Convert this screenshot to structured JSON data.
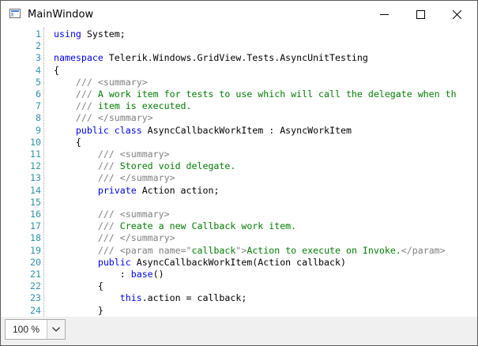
{
  "window": {
    "title": "MainWindow",
    "app_icon": "window-app-icon",
    "controls": {
      "minimize_icon": "minimize-icon",
      "maximize_icon": "maximize-icon",
      "close_icon": "close-icon"
    }
  },
  "editor": {
    "colors": {
      "keyword": "#0000ff",
      "comment": "#008000",
      "xml_doc_tag": "#808080",
      "string": "#a31515",
      "line_number": "#2b91af",
      "text": "#000000"
    },
    "lines": [
      {
        "number": "1",
        "tokens": [
          {
            "t": "kw",
            "v": "using"
          },
          {
            "t": "tx",
            "v": " System;"
          }
        ]
      },
      {
        "number": "2",
        "tokens": []
      },
      {
        "number": "3",
        "tokens": [
          {
            "t": "kw",
            "v": "namespace"
          },
          {
            "t": "tx",
            "v": " Telerik.Windows.GridView.Tests.AsyncUnitTesting"
          }
        ]
      },
      {
        "number": "4",
        "tokens": [
          {
            "t": "tx",
            "v": "{"
          }
        ]
      },
      {
        "number": "5",
        "tokens": [
          {
            "t": "tx",
            "v": "    "
          },
          {
            "t": "xml",
            "v": "///"
          },
          {
            "t": "cm",
            "v": " "
          },
          {
            "t": "xml",
            "v": "<summary>"
          }
        ]
      },
      {
        "number": "6",
        "tokens": [
          {
            "t": "tx",
            "v": "    "
          },
          {
            "t": "xml",
            "v": "///"
          },
          {
            "t": "cm",
            "v": " A work item for tests to use which will call the delegate when th"
          }
        ]
      },
      {
        "number": "7",
        "tokens": [
          {
            "t": "tx",
            "v": "    "
          },
          {
            "t": "xml",
            "v": "///"
          },
          {
            "t": "cm",
            "v": " item is executed."
          }
        ]
      },
      {
        "number": "8",
        "tokens": [
          {
            "t": "tx",
            "v": "    "
          },
          {
            "t": "xml",
            "v": "///"
          },
          {
            "t": "cm",
            "v": " "
          },
          {
            "t": "xml",
            "v": "</summary>"
          }
        ]
      },
      {
        "number": "9",
        "tokens": [
          {
            "t": "tx",
            "v": "    "
          },
          {
            "t": "kw",
            "v": "public"
          },
          {
            "t": "tx",
            "v": " "
          },
          {
            "t": "kw",
            "v": "class"
          },
          {
            "t": "tx",
            "v": " AsyncCallbackWorkItem : AsyncWorkItem"
          }
        ]
      },
      {
        "number": "10",
        "tokens": [
          {
            "t": "tx",
            "v": "    {"
          }
        ]
      },
      {
        "number": "11",
        "tokens": [
          {
            "t": "tx",
            "v": "        "
          },
          {
            "t": "xml",
            "v": "///"
          },
          {
            "t": "cm",
            "v": " "
          },
          {
            "t": "xml",
            "v": "<summary>"
          }
        ]
      },
      {
        "number": "12",
        "tokens": [
          {
            "t": "tx",
            "v": "        "
          },
          {
            "t": "xml",
            "v": "///"
          },
          {
            "t": "cm",
            "v": " Stored void delegate."
          }
        ]
      },
      {
        "number": "13",
        "tokens": [
          {
            "t": "tx",
            "v": "        "
          },
          {
            "t": "xml",
            "v": "///"
          },
          {
            "t": "cm",
            "v": " "
          },
          {
            "t": "xml",
            "v": "</summary>"
          }
        ]
      },
      {
        "number": "14",
        "tokens": [
          {
            "t": "tx",
            "v": "        "
          },
          {
            "t": "kw",
            "v": "private"
          },
          {
            "t": "tx",
            "v": " Action action;"
          }
        ]
      },
      {
        "number": "15",
        "tokens": []
      },
      {
        "number": "16",
        "tokens": [
          {
            "t": "tx",
            "v": "        "
          },
          {
            "t": "xml",
            "v": "///"
          },
          {
            "t": "cm",
            "v": " "
          },
          {
            "t": "xml",
            "v": "<summary>"
          }
        ]
      },
      {
        "number": "17",
        "tokens": [
          {
            "t": "tx",
            "v": "        "
          },
          {
            "t": "xml",
            "v": "///"
          },
          {
            "t": "cm",
            "v": " Create a new Callback work item."
          }
        ]
      },
      {
        "number": "18",
        "tokens": [
          {
            "t": "tx",
            "v": "        "
          },
          {
            "t": "xml",
            "v": "///"
          },
          {
            "t": "cm",
            "v": " "
          },
          {
            "t": "xml",
            "v": "</summary>"
          }
        ]
      },
      {
        "number": "19",
        "tokens": [
          {
            "t": "tx",
            "v": "        "
          },
          {
            "t": "xml",
            "v": "///"
          },
          {
            "t": "cm",
            "v": " "
          },
          {
            "t": "xml",
            "v": "<param name=\""
          },
          {
            "t": "cm",
            "v": "callback"
          },
          {
            "t": "xml",
            "v": "\">"
          },
          {
            "t": "cm",
            "v": "Action to execute on Invoke."
          },
          {
            "t": "xml",
            "v": "</param>"
          }
        ]
      },
      {
        "number": "20",
        "tokens": [
          {
            "t": "tx",
            "v": "        "
          },
          {
            "t": "kw",
            "v": "public"
          },
          {
            "t": "tx",
            "v": " AsyncCallbackWorkItem(Action callback)"
          }
        ]
      },
      {
        "number": "21",
        "tokens": [
          {
            "t": "tx",
            "v": "            : "
          },
          {
            "t": "kw",
            "v": "base"
          },
          {
            "t": "tx",
            "v": "()"
          }
        ]
      },
      {
        "number": "22",
        "tokens": [
          {
            "t": "tx",
            "v": "        {"
          }
        ]
      },
      {
        "number": "23",
        "tokens": [
          {
            "t": "tx",
            "v": "            "
          },
          {
            "t": "kw",
            "v": "this"
          },
          {
            "t": "tx",
            "v": ".action = callback;"
          }
        ]
      },
      {
        "number": "24",
        "tokens": [
          {
            "t": "tx",
            "v": "        }"
          }
        ]
      }
    ]
  },
  "statusbar": {
    "zoom_value": "100 %",
    "zoom_dropdown_icon": "chevron-down-icon"
  }
}
